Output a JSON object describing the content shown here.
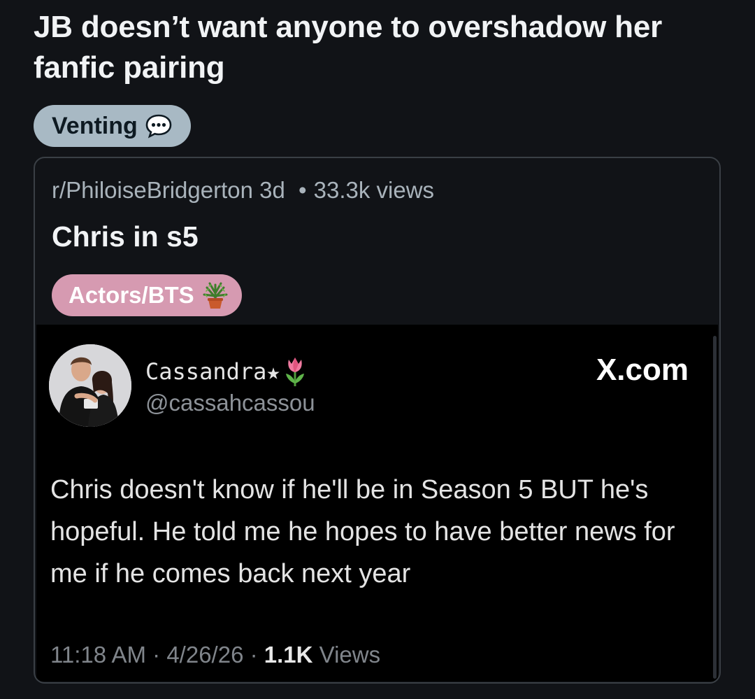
{
  "post": {
    "title": "JB doesn’t want anyone to overshadow her fanfic pairing",
    "flair": "Venting"
  },
  "crosspost": {
    "subreddit": "r/PhiloiseBridgerton",
    "age": "3d",
    "separator": "•",
    "views": "33.3k views",
    "title": "Chris in s5",
    "flair": "Actors/BTS"
  },
  "tweet": {
    "display_name": "Cassandra★",
    "handle": "@cassahcassou",
    "site": "X.com",
    "text": "Chris doesn't know if he'll be in Season 5 BUT he's hopeful. He told me he hopes to have better news for me if he comes back next year",
    "time": "11:18 AM",
    "date": "4/26/26",
    "sep": "·",
    "views_count": "1.1K",
    "views_label": "Views"
  },
  "colors": {
    "background": "#111317",
    "venting_flair": "#a8b9c4",
    "actors_flair": "#d69ab1",
    "card_border": "#3a3f45"
  },
  "icons": {
    "flair_icon": "speech-bubble-icon",
    "actors_flair_icon": "potted-plant-icon",
    "name_icon": "tulip-icon"
  }
}
